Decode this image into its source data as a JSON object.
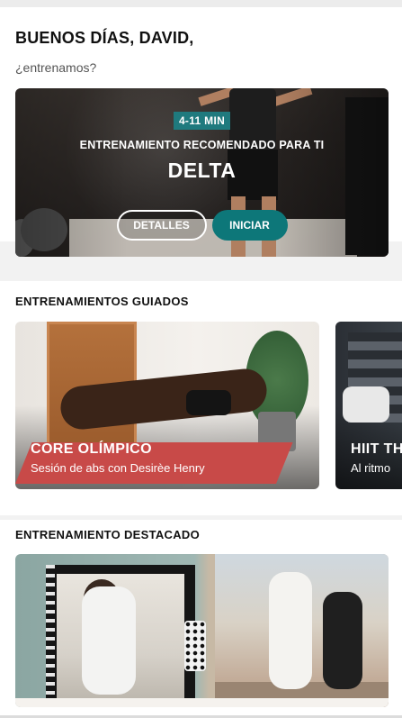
{
  "greeting": {
    "title": "BUENOS DÍAS, DAVID,",
    "subtitle": "¿entrenamos?"
  },
  "recommended": {
    "duration_badge": "4-11 MIN",
    "kicker": "ENTRENAMIENTO RECOMENDADO PARA TI",
    "workout_name": "DELTA",
    "details_button": "DETALLES",
    "start_button": "INICIAR"
  },
  "guided": {
    "heading": "ENTRENAMIENTOS GUIADOS",
    "cards": [
      {
        "title": "CORE OLÍMPICO",
        "subtitle": "Sesión de abs con Desirèe Henry"
      },
      {
        "title": "HIIT TH",
        "subtitle": "Al ritmo"
      }
    ]
  },
  "featured": {
    "heading": "ENTRENAMIENTO DESTACADO"
  },
  "colors": {
    "accent_teal": "#0d7779",
    "badge_teal": "#1f7a7e"
  }
}
